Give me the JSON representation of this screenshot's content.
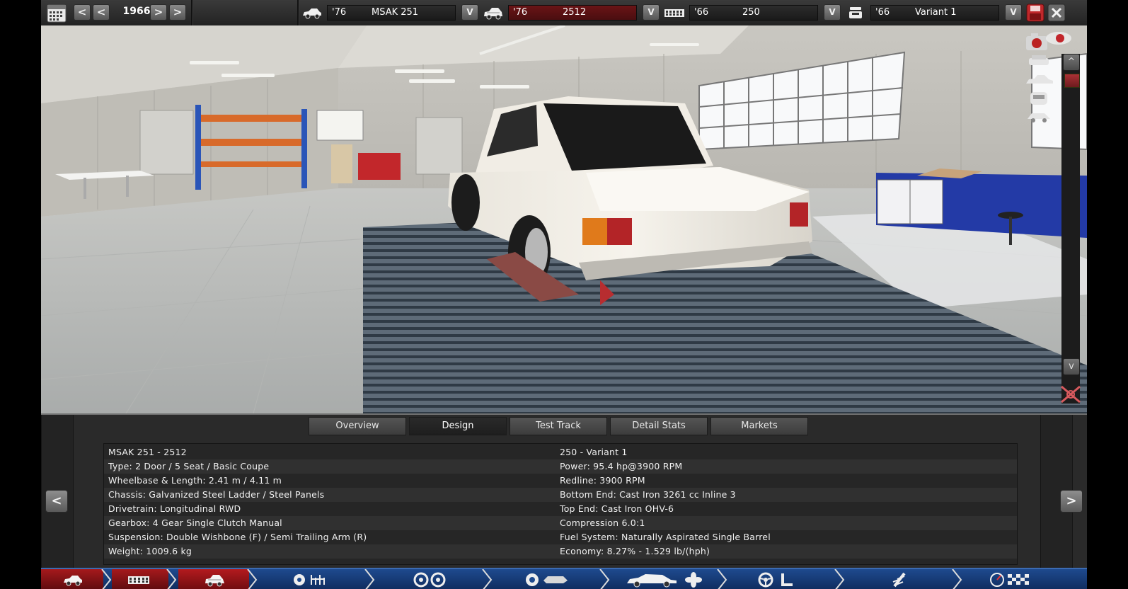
{
  "topbar": {
    "year": "1966",
    "year_prev_labels": [
      "<",
      "<"
    ],
    "year_next_labels": [
      ">",
      ">"
    ],
    "selectors": [
      {
        "icon": "car-body-icon",
        "year": "'76",
        "name": "MSAK 251",
        "dropdown": "V"
      },
      {
        "icon": "trim-icon",
        "year": "'76",
        "name": "2512",
        "dropdown": "V"
      },
      {
        "icon": "engine-family-icon",
        "year": "'66",
        "name": "250",
        "dropdown": "V"
      },
      {
        "icon": "engine-variant-icon",
        "year": "'66",
        "name": "Variant 1",
        "dropdown": "V"
      }
    ],
    "save_icon": "save-icon",
    "close_icon": "close-icon",
    "calendar_icon": "calendar-icon"
  },
  "viewport": {
    "camera_icons": [
      "camera-icon",
      "car-front-view-icon",
      "car-side-view-icon",
      "car-top-view-icon",
      "car-rear-view-icon"
    ],
    "scroll_up_label": "^",
    "scroll_down_label": "v"
  },
  "tabs": [
    {
      "label": "Overview",
      "active": false
    },
    {
      "label": "Design",
      "active": true
    },
    {
      "label": "Test Track",
      "active": false
    },
    {
      "label": "Detail Stats",
      "active": false
    },
    {
      "label": "Markets",
      "active": false
    }
  ],
  "nav": {
    "prev": "<",
    "next": ">"
  },
  "specs": {
    "left": [
      "MSAK 251 - 2512",
      "Type: 2 Door / 5 Seat / Basic Coupe",
      "Wheelbase & Length: 2.41 m / 4.11 m",
      "Chassis: Galvanized Steel Ladder / Steel Panels",
      "Drivetrain: Longitudinal RWD",
      "Gearbox: 4 Gear Single Clutch Manual",
      "Suspension: Double Wishbone (F) / Semi Trailing Arm (R)",
      "Weight: 1009.6 kg"
    ],
    "right": [
      "250 - Variant 1",
      "Power: 95.4 hp@3900 RPM",
      "Redline: 3900 RPM",
      "Bottom End: Cast Iron 3261 cc Inline 3",
      "Top End: Cast Iron OHV-6",
      "Compression 6.0:1",
      "Fuel System: Naturally Aspirated Single Barrel",
      "Economy: 8.27% - 1.529 lb/(hph)"
    ]
  },
  "bottom_nav": [
    {
      "icon": "car-model-icon"
    },
    {
      "icon": "engine-block-icon"
    },
    {
      "icon": "trim-body-icon"
    },
    {
      "icon": "suspension-icon"
    },
    {
      "icon": "wheels-icon"
    },
    {
      "icon": "brakes-fixture-icon"
    },
    {
      "icon": "car-body-cooling-icon"
    },
    {
      "icon": "interior-steering-icon"
    },
    {
      "icon": "test-spring-icon"
    },
    {
      "icon": "finish-gauge-icon"
    }
  ],
  "colors": {
    "accent_red": "#a5191c",
    "nav_blue": "#1e4a8e",
    "panel_bg": "#2a2a2a"
  }
}
